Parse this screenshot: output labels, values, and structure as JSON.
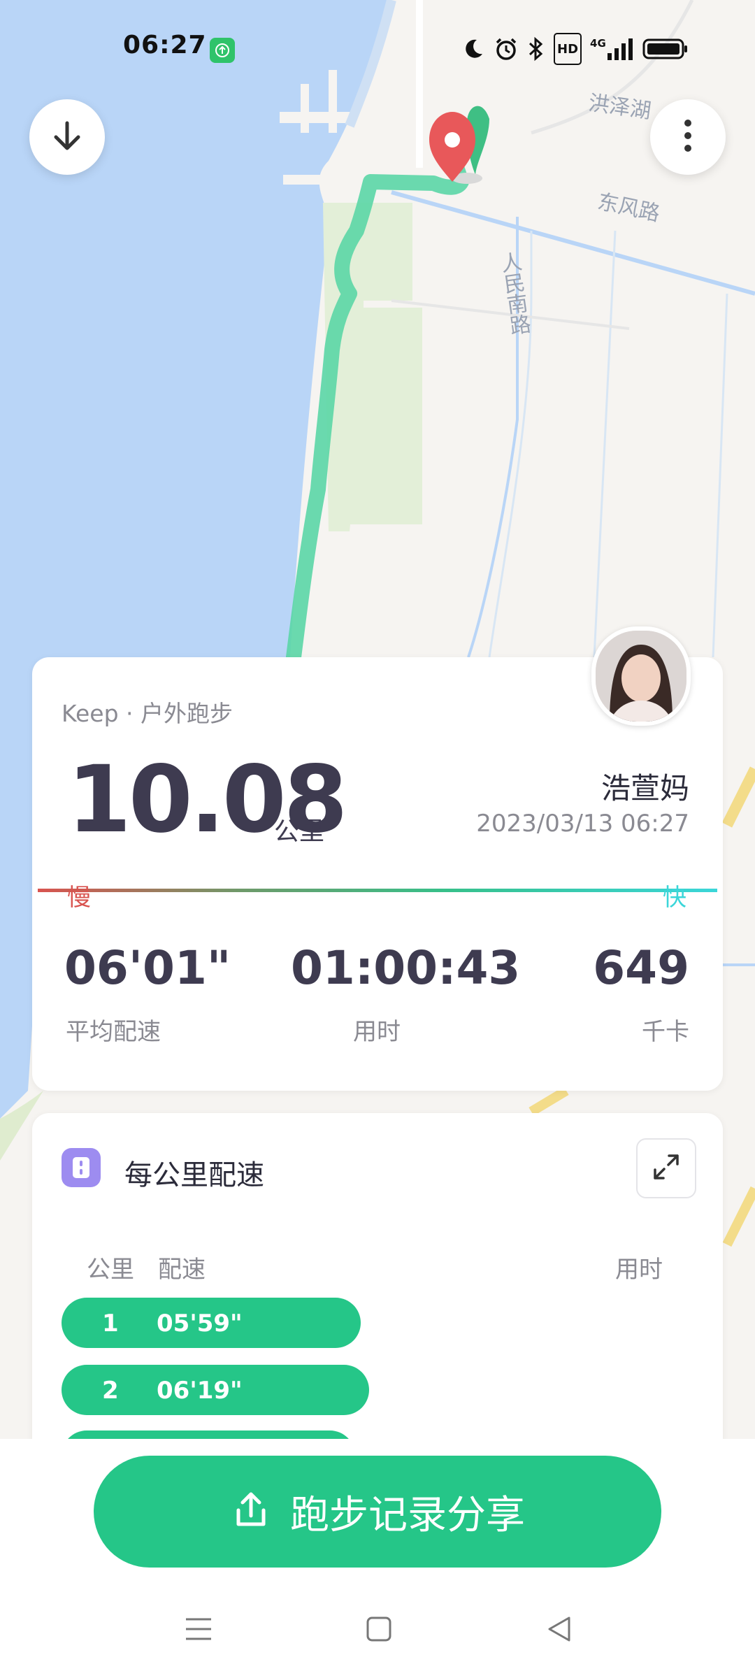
{
  "status_bar": {
    "time": "06:27",
    "icons": [
      "upload-icon",
      "moon-icon",
      "alarm-icon",
      "bluetooth-icon",
      "hd-icon",
      "4g-signal-icon",
      "battery-icon"
    ],
    "hd_label": "HD",
    "network_label": "4G"
  },
  "map": {
    "road_labels": [
      "洪泽湖",
      "东风路",
      "人民南路"
    ],
    "colors": {
      "water": "#b9d5f7",
      "land": "#f6f4f1",
      "green_area": "#e3efd8",
      "route": "#5bd6a6",
      "pin": "#e8585a",
      "pin_back": "#3fbf84"
    }
  },
  "summary": {
    "source": "Keep · 户外跑步",
    "distance": "10.08",
    "distance_unit": "公里",
    "username": "浩萱妈",
    "datetime": "2023/03/13 06:27",
    "slow_label": "慢",
    "fast_label": "快",
    "stats": [
      {
        "value": "06'01\"",
        "label": "平均配速"
      },
      {
        "value": "01:00:43",
        "label": "用时"
      },
      {
        "value": "649",
        "label": "千卡"
      }
    ]
  },
  "splits": {
    "title": "每公里配速",
    "col_km": "公里",
    "col_pace": "配速",
    "col_time": "用时",
    "rows": [
      {
        "km": "1",
        "pace": "05'59\""
      },
      {
        "km": "2",
        "pace": "06'19\""
      }
    ]
  },
  "share": {
    "label": "跑步记录分享"
  },
  "nav": {
    "icons": [
      "menu-icon",
      "home-square-icon",
      "back-triangle-icon"
    ]
  },
  "accent": "#25c688"
}
